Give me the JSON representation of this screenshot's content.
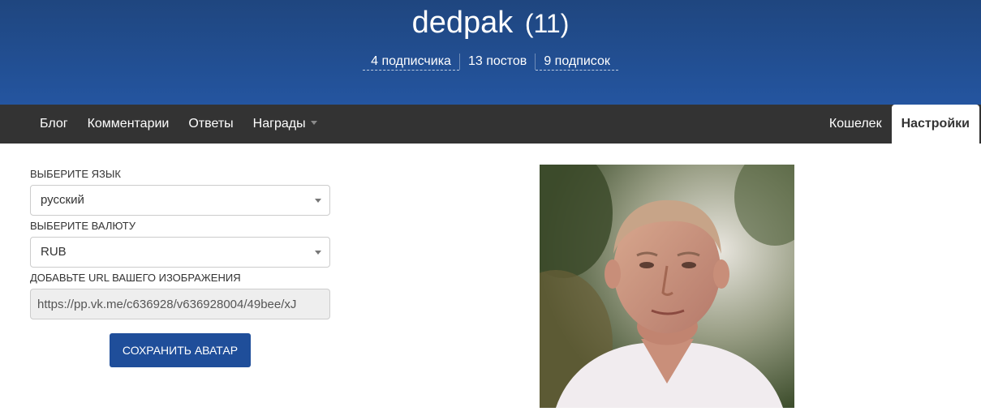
{
  "header": {
    "username": "dedpak",
    "rating": "(11)",
    "stats": {
      "subscribers": "4 подписчика",
      "posts": "13 постов",
      "subscriptions": "9 подписок"
    }
  },
  "nav": {
    "blog": "Блог",
    "comments": "Комментарии",
    "answers": "Ответы",
    "awards": "Награды",
    "wallet": "Кошелек",
    "settings": "Настройки"
  },
  "form": {
    "language": {
      "label": "Выберите язык",
      "value": "русский"
    },
    "currency": {
      "label": "Выберите валюту",
      "value": "RUB"
    },
    "image_url": {
      "label": "Добавьте URL вашего изображения",
      "value": "https://pp.vk.me/c636928/v636928004/49bee/xJ"
    },
    "save_button": "Сохранить аватар"
  },
  "colors": {
    "header_bg": "#2455a0",
    "navbar_bg": "#333333",
    "button_bg": "#1f4e9a"
  }
}
